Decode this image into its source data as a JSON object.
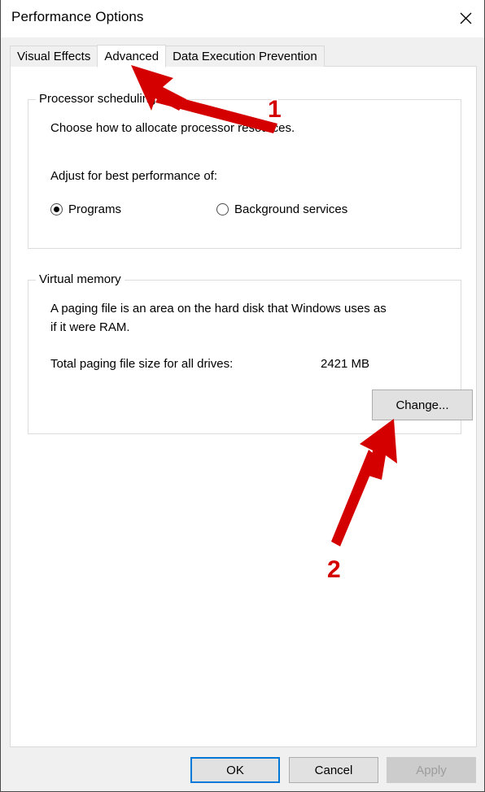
{
  "window": {
    "title": "Performance Options",
    "close_icon": "close-icon"
  },
  "tabs": [
    {
      "label": "Visual Effects",
      "selected": false
    },
    {
      "label": "Advanced",
      "selected": true
    },
    {
      "label": "Data Execution Prevention",
      "selected": false
    }
  ],
  "processor_scheduling": {
    "legend": "Processor scheduling",
    "description": "Choose how to allocate processor resources.",
    "prompt": "Adjust for best performance of:",
    "options": [
      {
        "label": "Programs",
        "checked": true
      },
      {
        "label": "Background services",
        "checked": false
      }
    ]
  },
  "virtual_memory": {
    "legend": "Virtual memory",
    "description_line1": "A paging file is an area on the hard disk that Windows uses as",
    "description_line2": "if it were RAM.",
    "total_label": "Total paging file size for all drives:",
    "total_value": "2421 MB",
    "change_button": "Change..."
  },
  "footer": {
    "ok_label": "OK",
    "cancel_label": "Cancel",
    "apply_label": "Apply"
  },
  "annotations": [
    {
      "number": "1",
      "target": "advanced-tab",
      "color": "#d40000"
    },
    {
      "number": "2",
      "target": "change-button",
      "color": "#d40000"
    }
  ],
  "colors": {
    "accent": "#0078d7",
    "annotation_red": "#d40000",
    "dialog_bg": "#f0f0f0",
    "panel_bg": "#ffffff",
    "button_face": "#e1e1e1",
    "disabled_text": "#9d9d9d"
  }
}
